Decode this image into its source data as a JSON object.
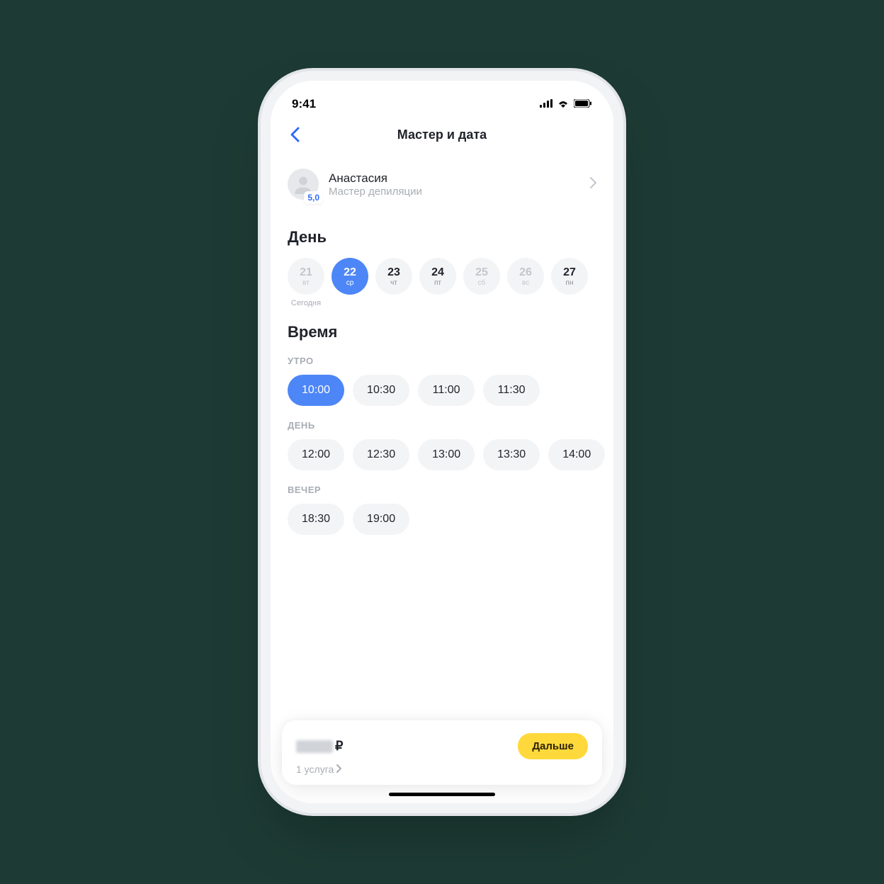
{
  "statusbar": {
    "time": "9:41"
  },
  "navbar": {
    "title": "Мастер и дата"
  },
  "master": {
    "name": "Анастасия",
    "role": "Мастер депиляции",
    "rating": "5,0"
  },
  "day_section": {
    "title": "День",
    "today_label": "Сегодня",
    "days": [
      {
        "num": "21",
        "dow": "вт",
        "state": "disabled",
        "is_today": true
      },
      {
        "num": "22",
        "dow": "ср",
        "state": "selected",
        "is_today": false
      },
      {
        "num": "23",
        "dow": "чт",
        "state": "normal",
        "is_today": false
      },
      {
        "num": "24",
        "dow": "пт",
        "state": "normal",
        "is_today": false
      },
      {
        "num": "25",
        "dow": "сб",
        "state": "disabled",
        "is_today": false
      },
      {
        "num": "26",
        "dow": "вс",
        "state": "disabled",
        "is_today": false
      },
      {
        "num": "27",
        "dow": "пн",
        "state": "normal",
        "is_today": false
      }
    ]
  },
  "time_section": {
    "title": "Время",
    "groups": [
      {
        "label": "УТРО",
        "slots": [
          {
            "t": "10:00",
            "selected": true
          },
          {
            "t": "10:30",
            "selected": false
          },
          {
            "t": "11:00",
            "selected": false
          },
          {
            "t": "11:30",
            "selected": false
          }
        ]
      },
      {
        "label": "ДЕНЬ",
        "slots": [
          {
            "t": "12:00",
            "selected": false
          },
          {
            "t": "12:30",
            "selected": false
          },
          {
            "t": "13:00",
            "selected": false
          },
          {
            "t": "13:30",
            "selected": false
          },
          {
            "t": "14:00",
            "selected": false
          }
        ]
      },
      {
        "label": "ВЕЧЕР",
        "slots": [
          {
            "t": "18:30",
            "selected": false
          },
          {
            "t": "19:00",
            "selected": false
          }
        ]
      }
    ]
  },
  "sheet": {
    "currency": "₽",
    "summary": "1 услуга",
    "next": "Дальше"
  }
}
